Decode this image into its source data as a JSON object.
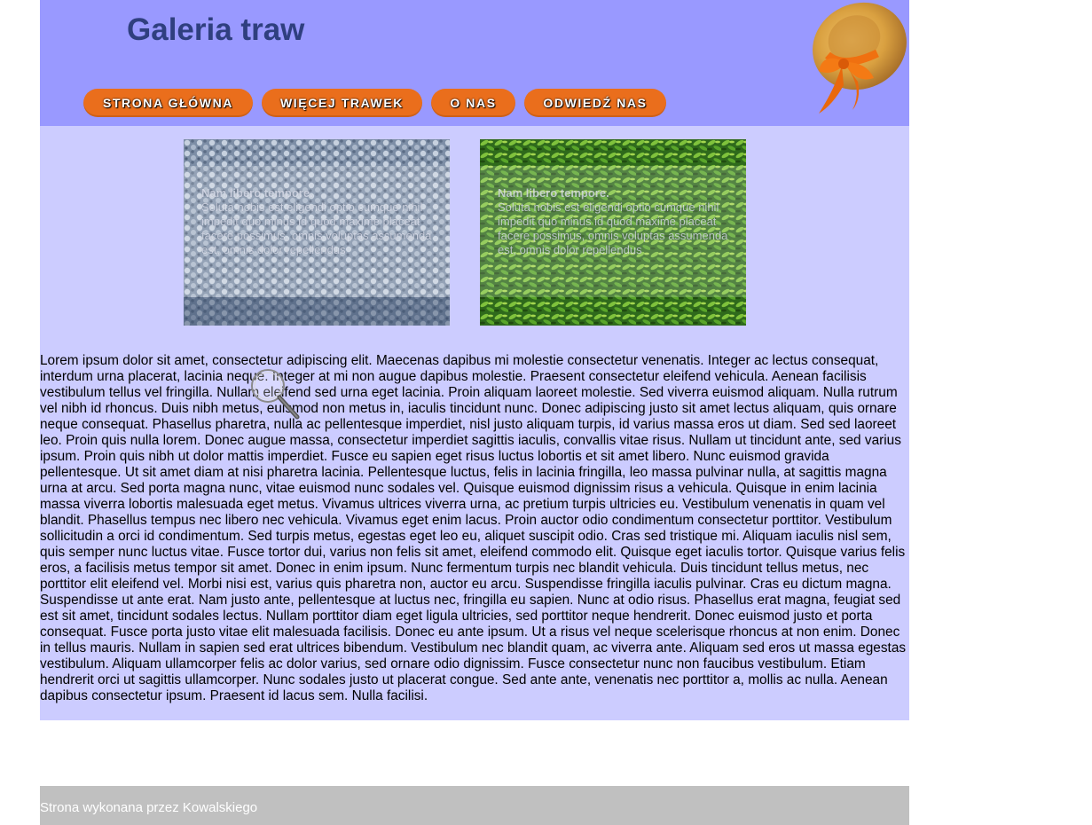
{
  "header": {
    "title": "Galeria traw",
    "hat_image": "straw-hat-with-orange-bow"
  },
  "nav": {
    "items": [
      {
        "label": "STRONA GŁÓWNA"
      },
      {
        "label": "WIĘCEJ TRAWEK"
      },
      {
        "label": "O NAS"
      },
      {
        "label": "ODWIEDŹ NAS"
      }
    ]
  },
  "gallery": {
    "tiles": [
      {
        "caption_title": "Nam libero tempore.",
        "caption_text": "Soluta nobis est eligendi optio cumque nihil impedit quo minus id quod maxime placeat facere possimus, omnis voluptas assumenda est, omnis dolor repellendus"
      },
      {
        "caption_title": "Nam libero tempore.",
        "caption_text": "Soluta nobis est eligendi optio cumque nihil impedit quo minus id quod maxime placeat facere possimus, omnis voluptas assumenda est, omnis dolor repellendus"
      }
    ]
  },
  "main": {
    "body_text": "Lorem ipsum dolor sit amet, consectetur adipiscing elit. Maecenas dapibus mi molestie consectetur venenatis. Integer ac lectus consequat, interdum urna placerat, lacinia neque. Integer at mi non augue dapibus molestie. Praesent consectetur eleifend vehicula. Aenean facilisis vestibulum tellus vel fringilla. Nullam eleifend sed urna eget lacinia. Proin aliquam laoreet molestie. Sed viverra euismod aliquam. Nulla rutrum vel nibh id rhoncus. Duis nibh metus, euismod non metus in, iaculis tincidunt nunc. Donec adipiscing justo sit amet lectus aliquam, quis ornare neque consequat. Phasellus pharetra, nulla ac pellentesque imperdiet, nisl justo aliquam turpis, id varius massa eros ut diam. Sed sed laoreet leo. Proin quis nulla lorem. Donec augue massa, consectetur imperdiet sagittis iaculis, convallis vitae risus. Nullam ut tincidunt ante, sed varius ipsum. Proin quis nibh ut dolor mattis imperdiet. Fusce eu sapien eget risus luctus lobortis et sit amet libero. Nunc euismod gravida pellentesque. Ut sit amet diam at nisi pharetra lacinia. Pellentesque luctus, felis in lacinia fringilla, leo massa pulvinar nulla, at sagittis magna urna at arcu. Sed porta magna nunc, vitae euismod nunc sodales vel. Quisque euismod dignissim risus a vehicula. Quisque in enim lacinia massa viverra lobortis malesuada eget metus. Vivamus ultrices viverra urna, ac pretium turpis ultricies eu. Vestibulum venenatis in quam vel blandit. Phasellus tempus nec libero nec vehicula. Vivamus eget enim lacus. Proin auctor odio condimentum consectetur porttitor. Vestibulum sollicitudin a orci id condimentum. Sed turpis metus, egestas eget leo eu, aliquet suscipit odio. Cras sed tristique mi. Aliquam iaculis nisl sem, quis semper nunc luctus vitae. Fusce tortor dui, varius non felis sit amet, eleifend commodo elit. Quisque eget iaculis tortor. Quisque varius felis eros, a facilisis metus tempor sit amet. Donec in enim ipsum. Nunc fermentum turpis nec blandit vehicula. Duis tincidunt tellus metus, nec porttitor elit eleifend vel. Morbi nisi est, varius quis pharetra non, auctor eu arcu. Suspendisse fringilla iaculis pulvinar. Cras eu dictum magna. Suspendisse ut ante erat. Nam justo ante, pellentesque at luctus nec, fringilla eu sapien. Nunc at odio risus. Phasellus erat magna, feugiat sed est sit amet, tincidunt sodales lectus. Nullam porttitor diam eget ligula ultricies, sed porttitor neque hendrerit. Donec euismod justo et porta consequat. Fusce porta justo vitae elit malesuada facilisis. Donec eu ante ipsum. Ut a risus vel neque scelerisque rhoncus at non enim. Donec in tellus mauris. Nullam in sapien sed erat ultrices bibendum. Vestibulum nec blandit quam, ac viverra ante. Aliquam sed eros ut massa egestas vestibulum. Aliquam ullamcorper felis ac dolor varius, sed ornare odio dignissim. Fusce consectetur nunc non faucibus vestibulum. Etiam hendrerit orci ut sagittis ullamcorper. Nunc sodales justo ut placerat congue. Sed ante ante, venenatis nec porttitor a, mollis ac nulla. Aenean dapibus consectetur ipsum. Praesent id lacus sem. Nulla facilisi."
  },
  "footer": {
    "text": "Strona wykonana przez Kowalskiego"
  },
  "colors": {
    "header_bg": "#9999ff",
    "content_bg": "#ccccff",
    "nav_button": "#ea6e1c",
    "title": "#2f3f7f",
    "footer_bg": "#c0c0c0"
  },
  "icons": {
    "cursor": "magnifier-cursor-icon"
  }
}
